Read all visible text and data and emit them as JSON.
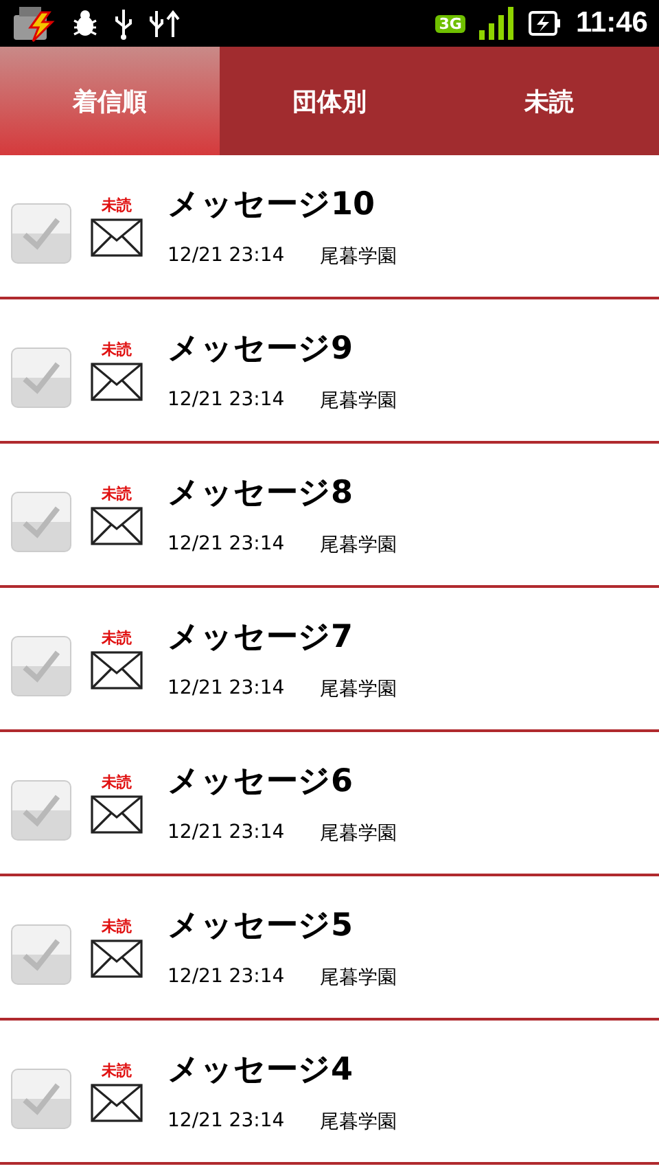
{
  "status_bar": {
    "network": "3G",
    "time": "11:46"
  },
  "tabs": [
    {
      "label": "着信順",
      "selected": true
    },
    {
      "label": "団体別",
      "selected": false
    },
    {
      "label": "未読",
      "selected": false
    }
  ],
  "messages": [
    {
      "title": "メッセージ10",
      "badge": "未読",
      "date": "12/21 23:14",
      "sender": "尾暮学園",
      "checked": false
    },
    {
      "title": "メッセージ9",
      "badge": "未読",
      "date": "12/21 23:14",
      "sender": "尾暮学園",
      "checked": false
    },
    {
      "title": "メッセージ8",
      "badge": "未読",
      "date": "12/21 23:14",
      "sender": "尾暮学園",
      "checked": false
    },
    {
      "title": "メッセージ7",
      "badge": "未読",
      "date": "12/21 23:14",
      "sender": "尾暮学園",
      "checked": false
    },
    {
      "title": "メッセージ6",
      "badge": "未読",
      "date": "12/21 23:14",
      "sender": "尾暮学園",
      "checked": false
    },
    {
      "title": "メッセージ5",
      "badge": "未読",
      "date": "12/21 23:14",
      "sender": "尾暮学園",
      "checked": false
    },
    {
      "title": "メッセージ4",
      "badge": "未読",
      "date": "12/21 23:14",
      "sender": "尾暮学園",
      "checked": false
    }
  ]
}
